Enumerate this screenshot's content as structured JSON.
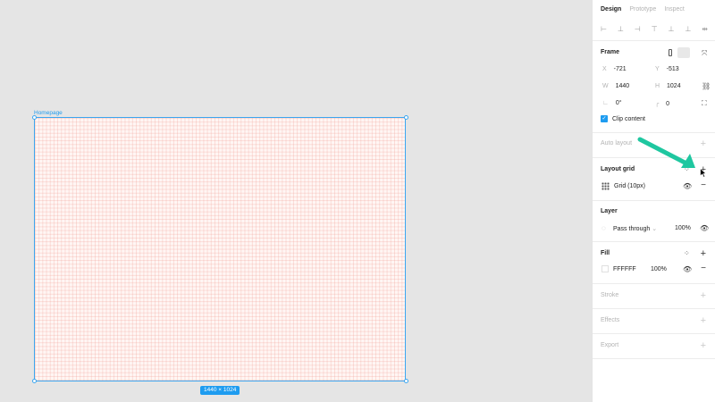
{
  "canvas": {
    "frame_label": "Homepage",
    "size_tag": "1440 × 1024"
  },
  "tabs": [
    {
      "label": "Design"
    },
    {
      "label": "Prototype"
    },
    {
      "label": "Inspect"
    }
  ],
  "frame_section": {
    "title": "Frame",
    "x_label": "X",
    "x_value": "-721",
    "y_label": "Y",
    "y_value": "-513",
    "w_label": "W",
    "w_value": "1440",
    "h_label": "H",
    "h_value": "1024",
    "rotation": "0°",
    "radius": "0",
    "clip_content_label": "Clip content"
  },
  "auto_layout": {
    "title": "Auto layout"
  },
  "layout_grid": {
    "title": "Layout grid",
    "item_label": "Grid (10px)"
  },
  "layer": {
    "title": "Layer",
    "blend": "Pass through",
    "opacity": "100%"
  },
  "fill": {
    "title": "Fill",
    "hex": "FFFFFF",
    "opacity": "100%"
  },
  "stroke": {
    "title": "Stroke"
  },
  "effects": {
    "title": "Effects"
  },
  "export": {
    "title": "Export"
  },
  "colors": {
    "accent": "#1e9cf0",
    "arrow": "#1fc7a0"
  }
}
